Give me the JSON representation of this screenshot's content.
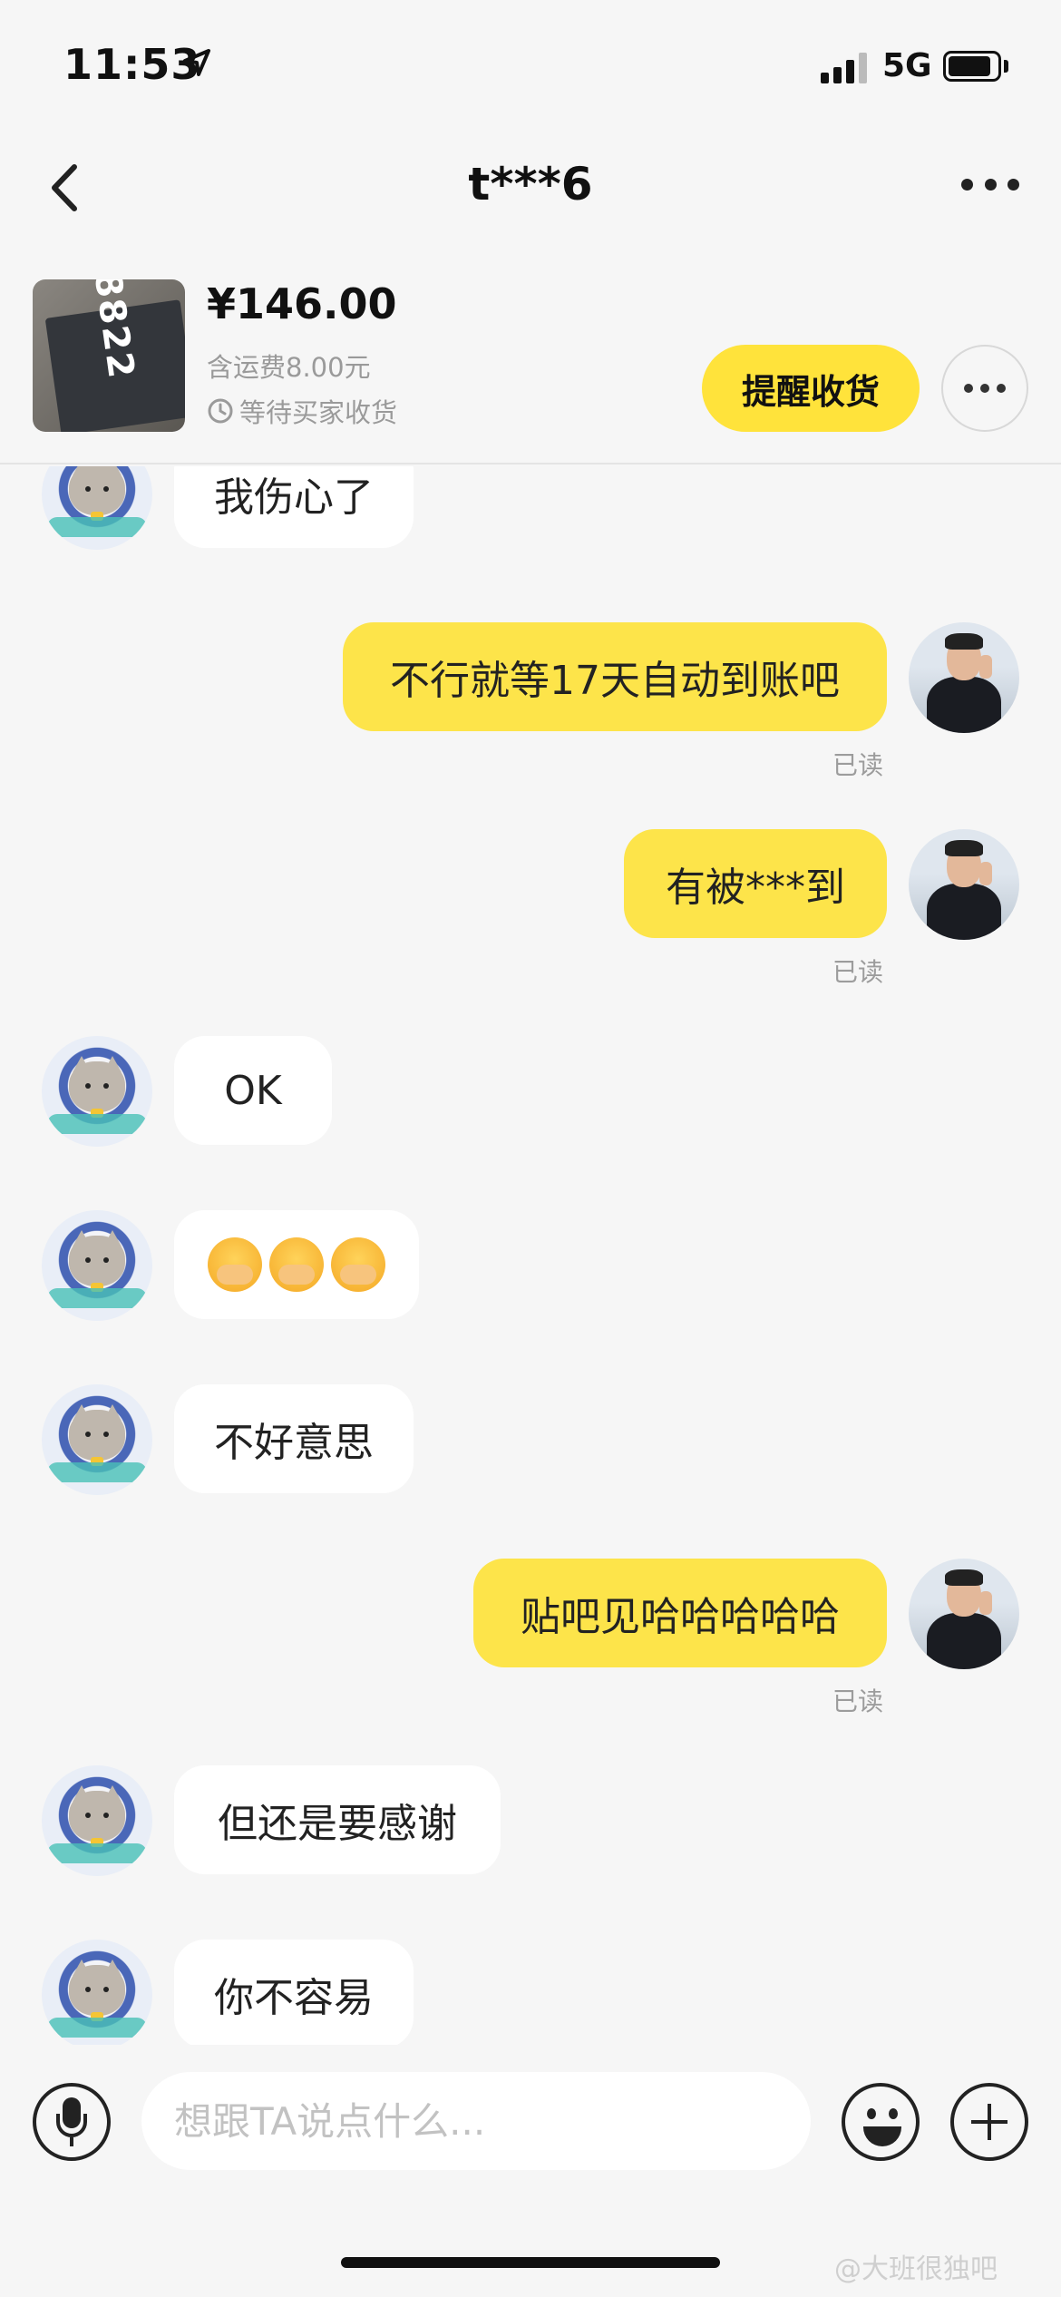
{
  "status_bar": {
    "time": "11:53",
    "network": "5G"
  },
  "nav": {
    "title": "t***6"
  },
  "product": {
    "price": "¥146.00",
    "shipping": "含运费8.00元",
    "status": "等待买家收货",
    "remind_button": "提醒收货"
  },
  "messages": [
    {
      "side": "in",
      "text": "我伤心了"
    },
    {
      "side": "out",
      "text": "不行就等17天自动到账吧",
      "read": "已读"
    },
    {
      "side": "out",
      "text": "有被***到",
      "read": "已读"
    },
    {
      "side": "in",
      "text": "OK"
    },
    {
      "side": "in",
      "emoji_count": 3
    },
    {
      "side": "in",
      "text": "不好意思"
    },
    {
      "side": "out",
      "text": "贴吧见哈哈哈哈哈",
      "read": "已读"
    },
    {
      "side": "in",
      "text": "但还是要感谢"
    },
    {
      "side": "in",
      "text": "你不容易"
    }
  ],
  "input": {
    "placeholder": "想跟TA说点什么..."
  },
  "watermark": "@大班很独吧"
}
